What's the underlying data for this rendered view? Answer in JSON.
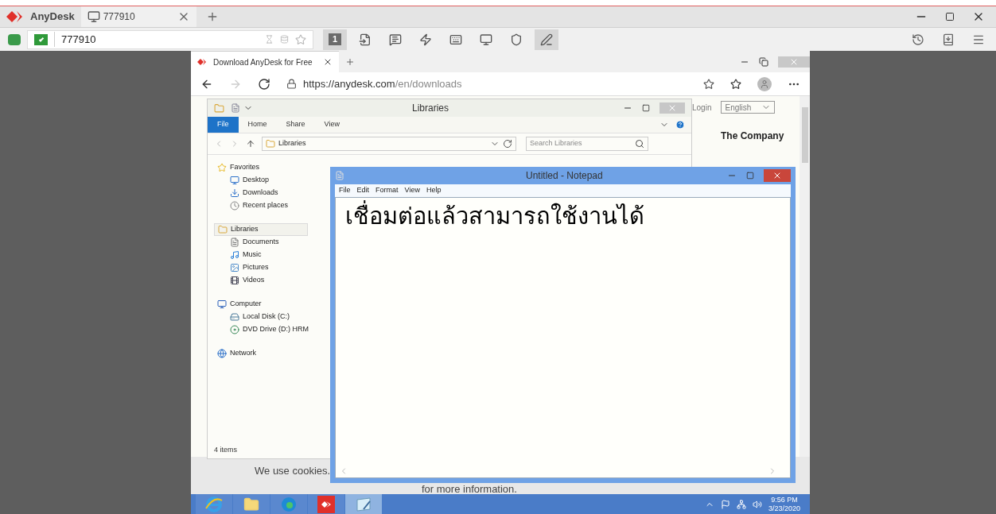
{
  "anydesk": {
    "app_name": "AnyDesk",
    "tabs": [
      {
        "label": "777910",
        "selected": true
      }
    ],
    "address": "777910",
    "toolbar": [
      {
        "kind": "display",
        "label": "1",
        "selected": true
      },
      {
        "kind": "transfer",
        "selected": false
      },
      {
        "kind": "chat",
        "selected": false
      },
      {
        "kind": "actions",
        "selected": false
      },
      {
        "kind": "keyboard",
        "selected": false
      },
      {
        "kind": "view",
        "selected": false
      },
      {
        "kind": "permissions",
        "selected": false
      },
      {
        "kind": "draw",
        "selected": true
      }
    ]
  },
  "browser": {
    "tab_title": "Download AnyDesk for Free",
    "url_host": "https://anydesk.com",
    "url_path": "/en/downloads",
    "page": {
      "login": "Login",
      "language": "English",
      "heading": "The Company",
      "cookie_text": "We use cookies.",
      "cookie_more": "for more information."
    }
  },
  "explorer": {
    "title": "Libraries",
    "ribbon_tabs": [
      {
        "label": "File",
        "selected": true
      },
      {
        "label": "Home",
        "selected": false
      },
      {
        "label": "Share",
        "selected": false
      },
      {
        "label": "View",
        "selected": false
      }
    ],
    "breadcrumb": "Libraries",
    "search_placeholder": "Search Libraries",
    "nav": [
      {
        "label": "Favorites",
        "kind": "favorites",
        "selected": false,
        "children": [
          {
            "label": "Desktop",
            "kind": "desktop"
          },
          {
            "label": "Downloads",
            "kind": "downloads"
          },
          {
            "label": "Recent places",
            "kind": "recent"
          }
        ]
      },
      {
        "label": "Libraries",
        "kind": "libraries",
        "selected": true,
        "children": [
          {
            "label": "Documents",
            "kind": "documents"
          },
          {
            "label": "Music",
            "kind": "music"
          },
          {
            "label": "Pictures",
            "kind": "pictures"
          },
          {
            "label": "Videos",
            "kind": "videos"
          }
        ]
      },
      {
        "label": "Computer",
        "kind": "computer",
        "selected": false,
        "children": [
          {
            "label": "Local Disk (C:)",
            "kind": "disk"
          },
          {
            "label": "DVD Drive (D:) HRM",
            "kind": "dvd"
          }
        ]
      },
      {
        "label": "Network",
        "kind": "network",
        "selected": false
      }
    ],
    "status": "4 items"
  },
  "notepad": {
    "title": "Untitled - Notepad",
    "menu": [
      "File",
      "Edit",
      "Format",
      "View",
      "Help"
    ],
    "text": "เชื่อมต่อแล้วสามารถใช้งานได้"
  },
  "taskbar": {
    "apps": [
      {
        "kind": "ie",
        "selected": false
      },
      {
        "kind": "explorer",
        "selected": false
      },
      {
        "kind": "edge",
        "selected": false
      },
      {
        "kind": "anydesk",
        "selected": false
      },
      {
        "kind": "notepad",
        "selected": true
      }
    ],
    "time": "9:56 PM",
    "date": "3/23/2020"
  }
}
